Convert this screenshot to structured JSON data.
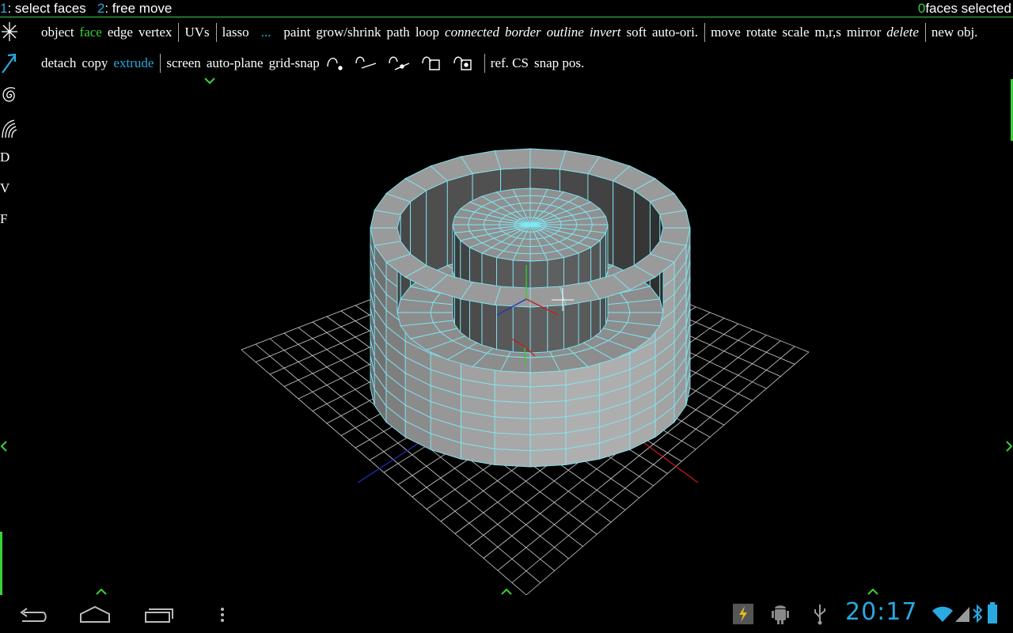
{
  "hint": {
    "key1": "1",
    "label1": ": select faces",
    "key2": "2",
    "label2": ": free move",
    "count": "0",
    "count_label": "faces selected"
  },
  "toolbar_row1": {
    "object": "object",
    "face": "face",
    "edge": "edge",
    "vertex": "vertex",
    "uvs": "UVs",
    "lasso": "lasso",
    "more": "...",
    "paint": "paint",
    "grow_shrink": "grow/shrink",
    "path": "path",
    "loop": "loop",
    "connected": "connected",
    "border": "border",
    "outline": "outline",
    "invert": "invert",
    "soft": "soft",
    "auto_ori": "auto-ori.",
    "move": "move",
    "rotate": "rotate",
    "scale": "scale",
    "mrs": "m,r,s",
    "mirror": "mirror",
    "delete": "delete",
    "new_obj": "new obj."
  },
  "toolbar_row2": {
    "detach": "detach",
    "copy": "copy",
    "extrude": "extrude",
    "screen": "screen",
    "auto_plane": "auto-plane",
    "grid_snap": "grid-snap",
    "ref_cs": "ref. CS",
    "snap_pos": "snap pos."
  },
  "left_tools": {
    "d": "D",
    "v": "V",
    "f": "F"
  },
  "status": {
    "clock": "20:17"
  },
  "icons": {
    "row2": [
      "snap-point-icon",
      "snap-edge-icon",
      "snap-edge-point-icon",
      "snap-face-icon",
      "snap-face-point-icon"
    ],
    "left": [
      "star-icon",
      "arrow-icon",
      "spiral-icon",
      "arcs-icon"
    ],
    "nav": [
      "back-icon",
      "home-icon",
      "recent-apps-icon",
      "menu-icon"
    ],
    "status": [
      "usb-debug-icon",
      "android-icon",
      "usb-icon",
      "wifi-icon",
      "signal-icon",
      "bluetooth-icon",
      "battery-icon"
    ]
  },
  "colors": {
    "accent_green": "#3ad13a",
    "accent_blue": "#2aa8e0",
    "mesh_fill": "#8a8a8a",
    "mesh_wire": "#7ee8f5"
  }
}
